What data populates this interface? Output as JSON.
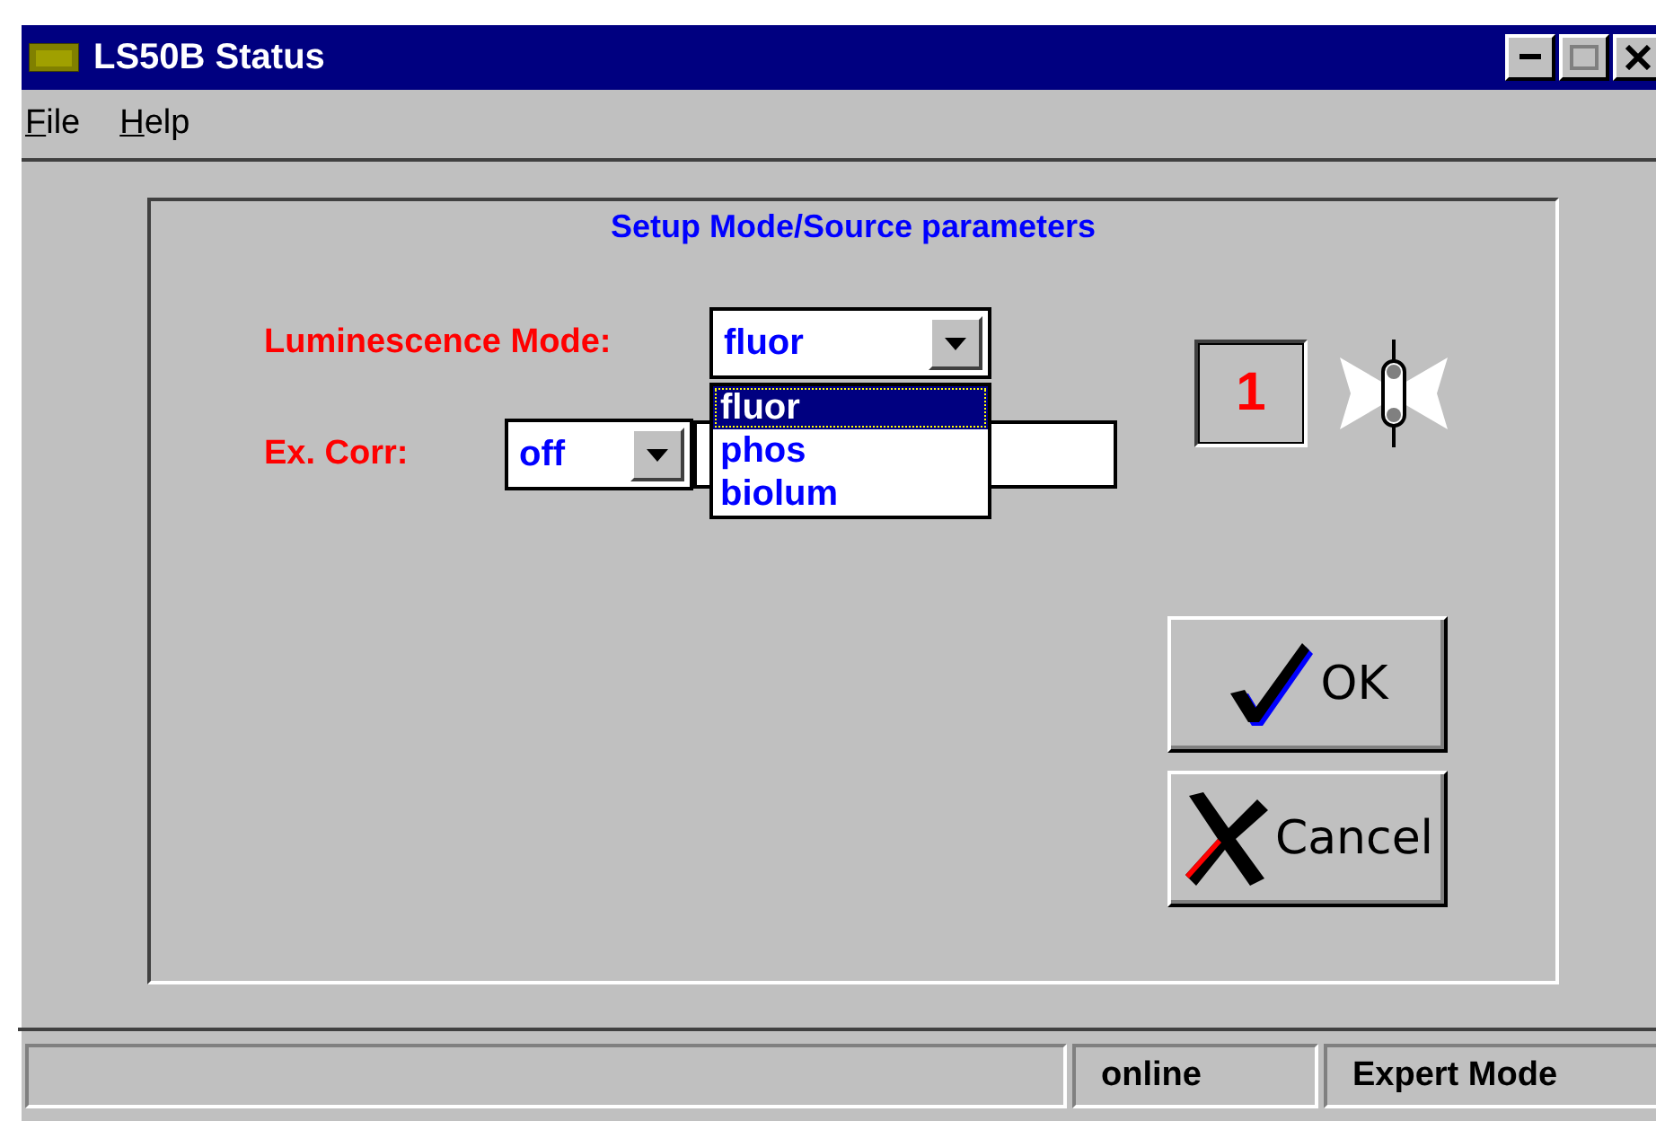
{
  "window": {
    "title": "LS50B Status"
  },
  "menu": [
    {
      "label": "File"
    },
    {
      "label": "Help"
    }
  ],
  "panel": {
    "title": "Setup Mode/Source parameters",
    "mode": {
      "label": "Luminescence Mode:",
      "value": "fluor",
      "expanded": true,
      "options": [
        {
          "label": "fluor",
          "selected": true
        },
        {
          "label": "phos",
          "selected": false
        },
        {
          "label": "biolum",
          "selected": false
        }
      ]
    },
    "correction": {
      "label": "Ex. Corr:",
      "value": "off"
    },
    "source_number": "1",
    "buttons": [
      {
        "kind": "ok",
        "label": "OK"
      },
      {
        "kind": "cancel",
        "label": "Cancel"
      }
    ]
  },
  "status_bar": [
    "online",
    "Expert Mode"
  ]
}
